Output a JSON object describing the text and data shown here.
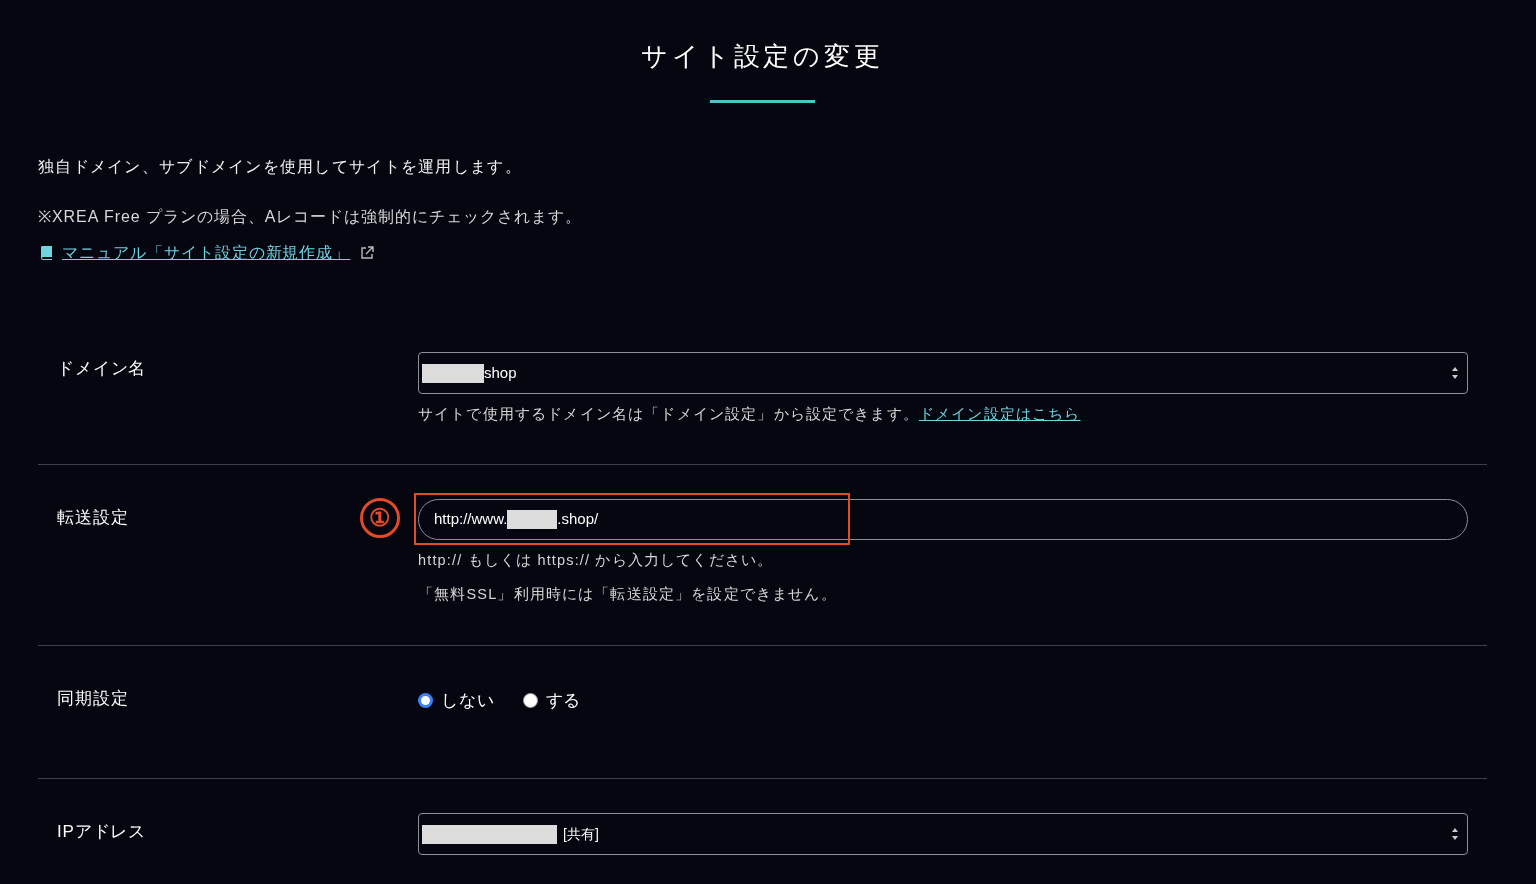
{
  "dialog": {
    "title": "サイト設定の変更",
    "intro": "独自ドメイン、サブドメインを使用してサイトを運用します。",
    "note": "※XREA Free プランの場合、Aレコードは強制的にチェックされます。",
    "manual_link": "マニュアル「サイト設定の新規作成」",
    "rows": [
      {
        "kind": "select",
        "label": "ドメイン名",
        "value_after": "shop",
        "help": [
          {
            "text": "サイトで使用するドメイン名は「ドメイン設定」から設定できます。",
            "link": "ドメイン設定はこちら"
          }
        ]
      },
      {
        "kind": "text",
        "label": "転送設定",
        "value_before": "http://www.",
        "value_after": ".shop/",
        "annotation": "①",
        "help": [
          {
            "text": "http:// もしくは https:// から入力してください。"
          },
          {
            "text": "「無料SSL」利用時には「転送設定」を設定できません。"
          }
        ]
      },
      {
        "kind": "radio",
        "label": "同期設定",
        "options": [
          {
            "label": "しない",
            "selected": true
          },
          {
            "label": "する",
            "selected": false
          }
        ]
      },
      {
        "kind": "select",
        "label": "IPアドレス",
        "value_after": "[共有]"
      }
    ]
  }
}
